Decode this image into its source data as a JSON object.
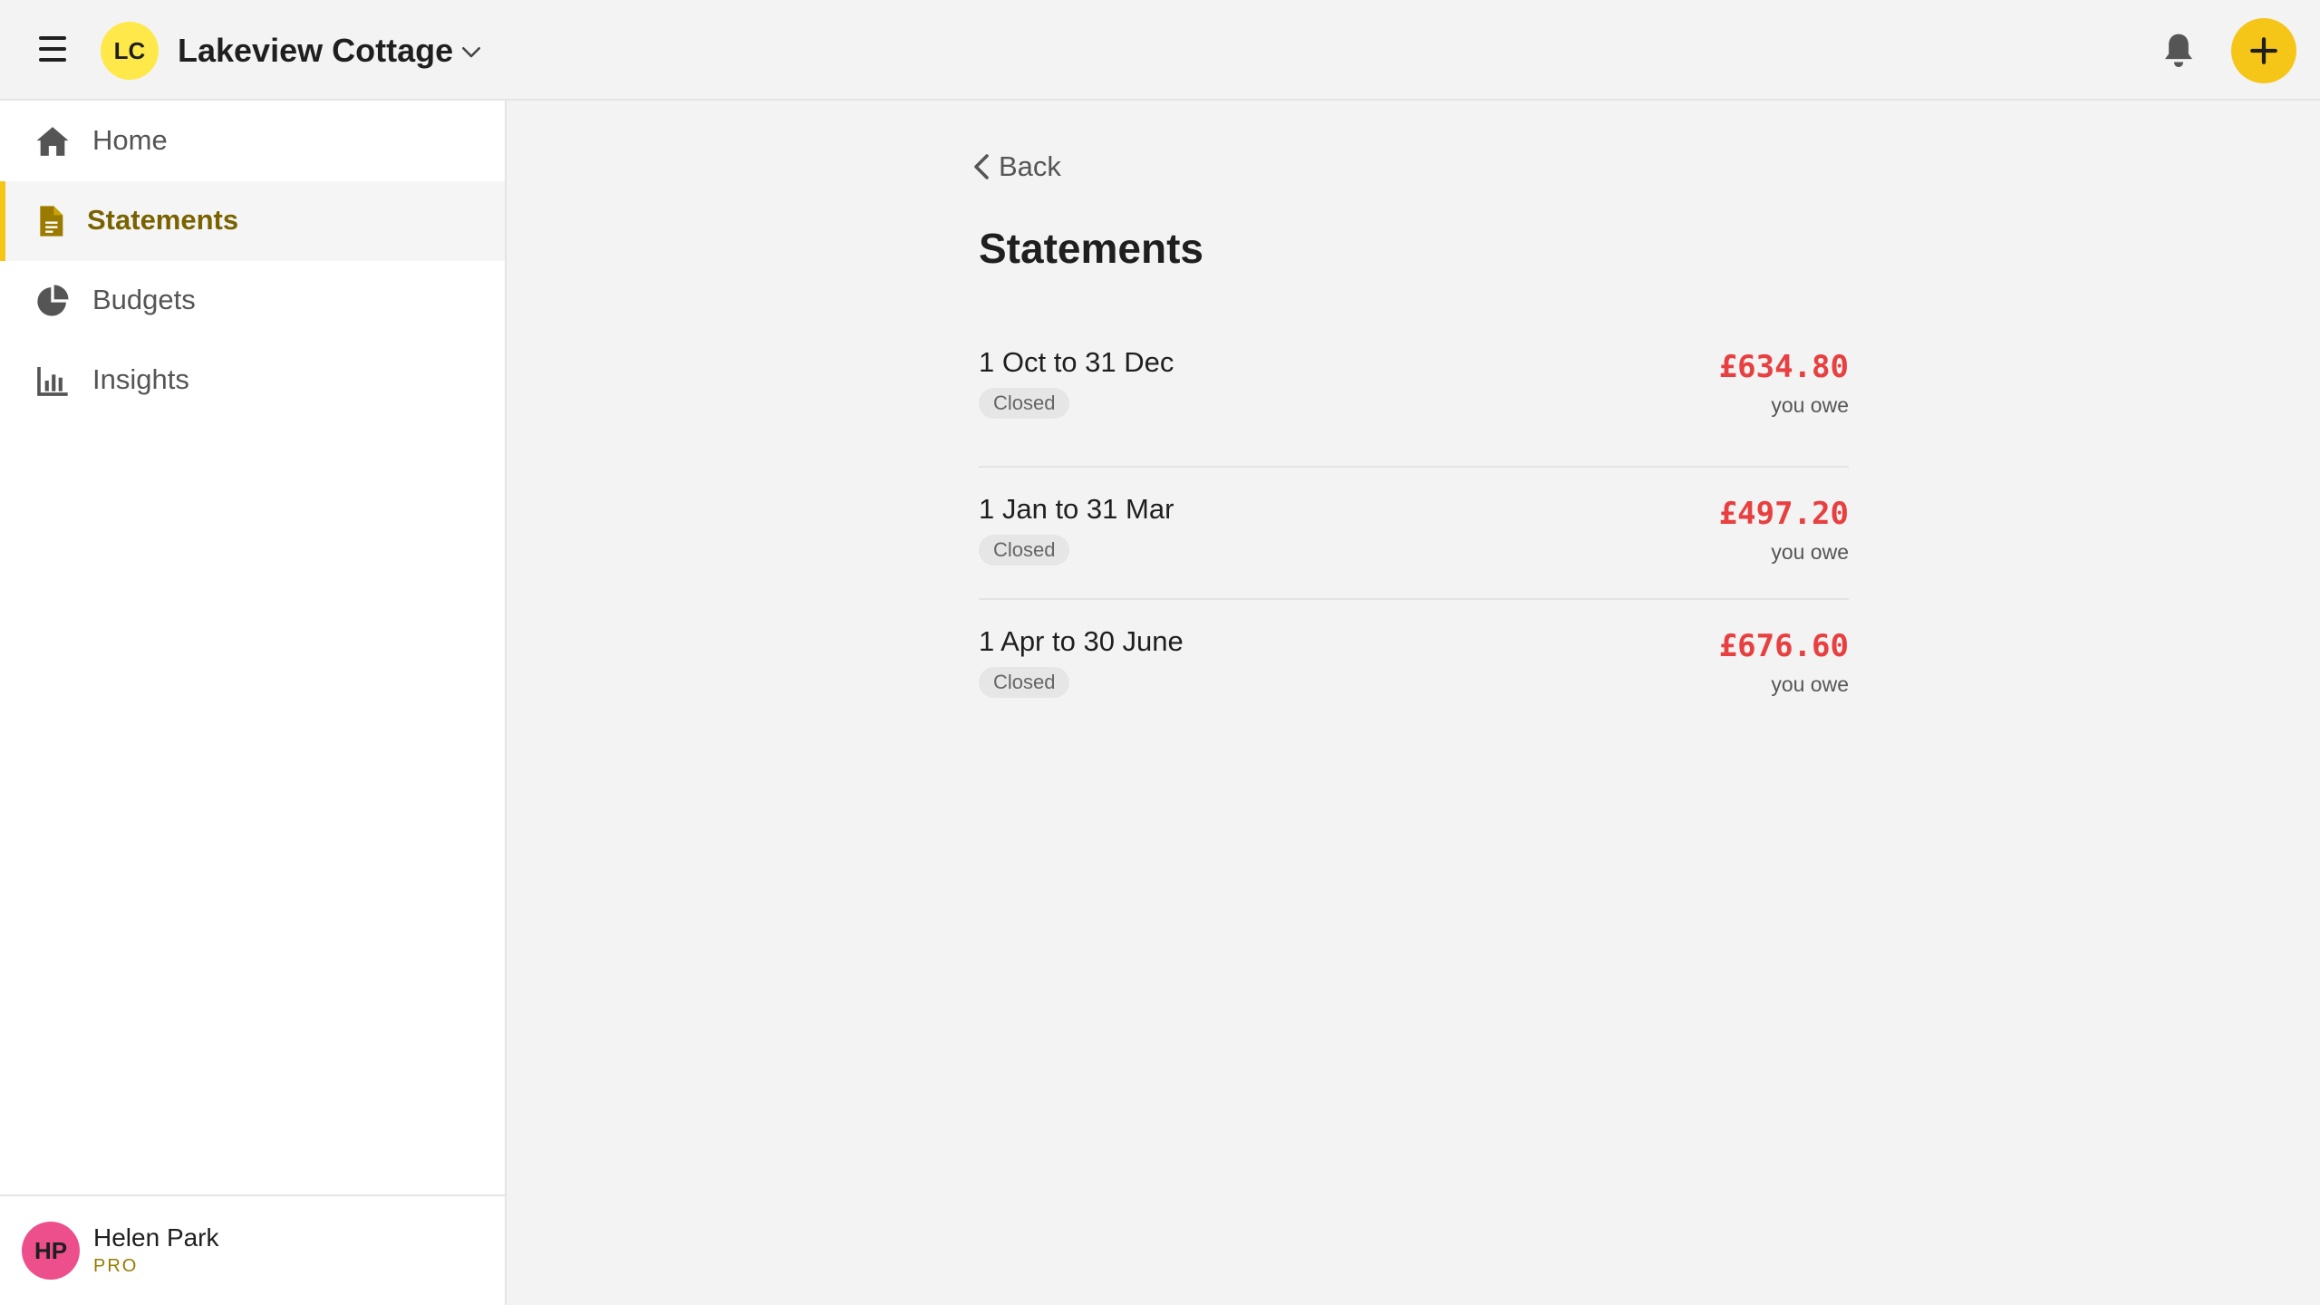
{
  "header": {
    "org_initials": "LC",
    "org_name": "Lakeview Cottage"
  },
  "sidebar": {
    "items": [
      {
        "label": "Home",
        "icon": "home-icon",
        "active": false
      },
      {
        "label": "Statements",
        "icon": "document-icon",
        "active": true
      },
      {
        "label": "Budgets",
        "icon": "pie-chart-icon",
        "active": false
      },
      {
        "label": "Insights",
        "icon": "bar-chart-icon",
        "active": false
      }
    ],
    "user": {
      "initials": "HP",
      "name": "Helen Park",
      "plan": "PRO"
    }
  },
  "main": {
    "back_label": "Back",
    "title": "Statements",
    "statements": [
      {
        "period": "1 Oct to 31 Dec",
        "status": "Closed",
        "amount": "£634.80",
        "note": "you owe"
      },
      {
        "period": "1 Jan to 31 Mar",
        "status": "Closed",
        "amount": "£497.20",
        "note": "you owe"
      },
      {
        "period": "1 Apr to 30 June",
        "status": "Closed",
        "amount": "£676.60",
        "note": "you owe"
      }
    ]
  },
  "colors": {
    "accent": "#f5c518",
    "active_text": "#7a6200",
    "amount_owed": "#e84040",
    "org_avatar": "#ffe94a",
    "user_avatar": "#ec4f8c"
  }
}
